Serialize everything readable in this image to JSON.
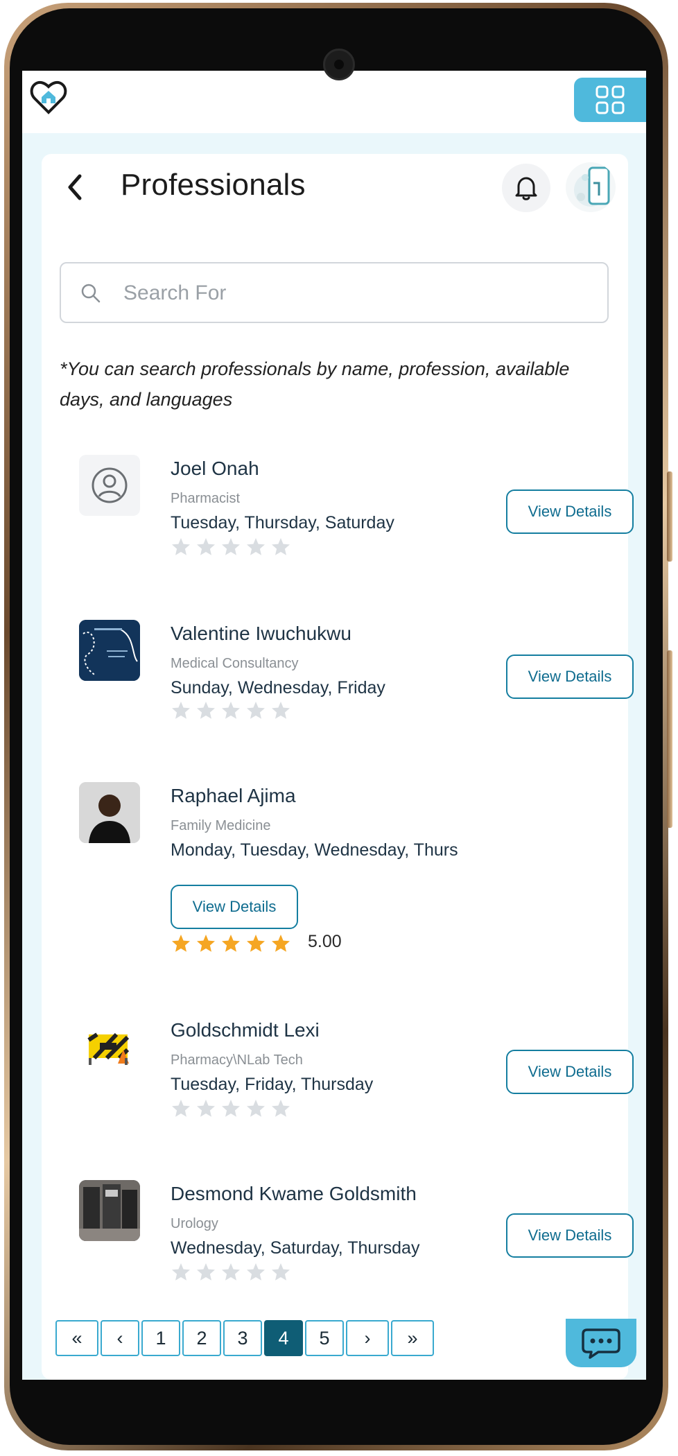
{
  "header": {
    "title": "Professionals",
    "logo_icon": "heart-home-icon",
    "menu_icon": "grid-menu-icon",
    "notification_icon": "bell-icon",
    "colors": {
      "accent": "#4fb9dc",
      "primary_dark": "#0f5d75",
      "button_border": "#147ea0",
      "star_active": "#f5a623",
      "star_inactive": "#d9dde1"
    }
  },
  "search": {
    "placeholder": "Search For",
    "value": "",
    "hint": "*You can search professionals by name, profession, available days, and languages"
  },
  "professionals": [
    {
      "name": "Joel Onah",
      "role": "Pharmacist",
      "days": "Tuesday, Thursday, Saturday",
      "rating": 0,
      "rating_text": "",
      "button": "View Details",
      "photo": "default-avatar-icon"
    },
    {
      "name": "Valentine Iwuchukwu",
      "role": "Medical Consultancy",
      "days": "Sunday, Wednesday, Friday",
      "rating": 0,
      "rating_text": "",
      "button": "View Details",
      "photo": "profile-photo"
    },
    {
      "name": "Raphael Ajima",
      "role": "Family Medicine",
      "days": "Monday, Tuesday, Wednesday, Thurs",
      "rating": 5,
      "rating_text": "5.00",
      "button": "View Details",
      "photo": "profile-photo"
    },
    {
      "name": "Goldschmidt Lexi",
      "role": "Pharmacy\\NLab Tech",
      "days": "Tuesday, Friday, Thursday",
      "rating": 0,
      "rating_text": "",
      "button": "View Details",
      "photo": "profile-photo"
    },
    {
      "name": "Desmond Kwame Goldsmith",
      "role": "Urology",
      "days": "Wednesday, Saturday, Thursday",
      "rating": 0,
      "rating_text": "",
      "button": "View Details",
      "photo": "profile-photo"
    }
  ],
  "pagination": {
    "first": "«",
    "prev": "‹",
    "pages": [
      "1",
      "2",
      "3",
      "4",
      "5"
    ],
    "current": "4",
    "next": "›",
    "last": "»"
  },
  "chat": {
    "icon": "chat-bubble-icon"
  }
}
